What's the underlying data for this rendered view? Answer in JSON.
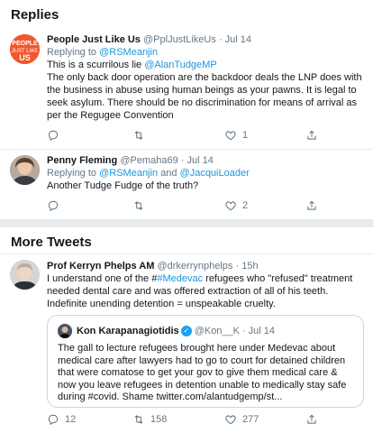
{
  "replies_header": "Replies",
  "more_tweets_header": "More Tweets",
  "tweets": [
    {
      "avatar_text": "PEOPLE JUST LIKE US",
      "name": "People Just Like Us",
      "handle": "@PplJustLikeUs",
      "dot": "·",
      "time": "Jul 14",
      "replying_prefix": "Replying to ",
      "replying_to": "@RSMeanjin",
      "line1_prefix": "This is a scurrilous lie ",
      "line1_mention": "@AlanTudgeMP",
      "body_rest": "The only back door operation are the backdoor deals the LNP does with the business in abuse using human beings as your pawns. It is legal to seek asylum. There should be no discrimination for means of arrival as per the Regugee Convention",
      "like_count": "1",
      "avatar_color": "#f2572b"
    },
    {
      "name": "Penny Fleming",
      "handle": "@Pemaha69",
      "dot": "·",
      "time": "Jul 14",
      "replying_prefix": "Replying to ",
      "replying_to": "@RSMeanjin",
      "replying_and": " and ",
      "replying_to_2": "@JacquiLoader",
      "body": "Another Tudge Fudge of the truth?",
      "like_count": "2"
    },
    {
      "name": "Prof Kerryn Phelps AM",
      "handle": "@drkerrynphelps",
      "dot": "·",
      "time": "15h",
      "body_prefix": "I understand one of the #",
      "body_hashtag": "#Medevac",
      "body_rest": " refugees who \"refused\" treatment needed dental care and was offered extraction of all of his teeth. Indefinite unending detention = unspeakable cruelty.",
      "reply_count": "12",
      "retweet_count": "158",
      "like_count": "277",
      "quote": {
        "name": "Kon Karapanagiotidis",
        "verified": "✓",
        "handle": "@Kon__K",
        "dot": "·",
        "time": "Jul 14",
        "body": "The gall to lecture refugees brought here under Medevac about medical care after lawyers had to go to court for detained children that were comatose to get your gov to give them medical care & now you leave refugees in detention unable to  medically stay safe during #covid. Shame twitter.com/alantudgemp/st..."
      }
    }
  ],
  "colors": {
    "accent": "#1b95e0",
    "muted": "#657786",
    "background": "#e6ecf0"
  }
}
